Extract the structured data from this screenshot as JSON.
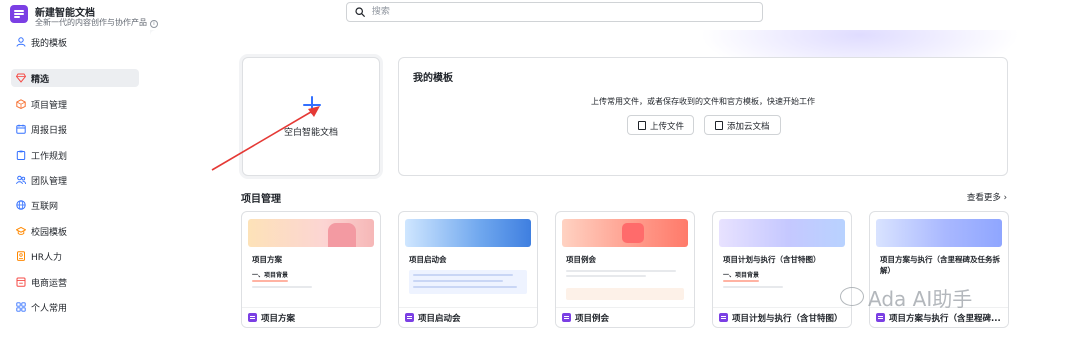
{
  "app": {
    "title": "新建智能文档",
    "subtitle": "全新一代的内容创作与协作产品",
    "brand_color": "#7b3fe4"
  },
  "search": {
    "placeholder": " 搜索"
  },
  "sidebar": {
    "items": [
      {
        "label": "我的模板",
        "icon": "user-icon",
        "active": false
      },
      {
        "label": "精选",
        "icon": "diamond-icon",
        "active": true
      },
      {
        "label": "项目管理",
        "icon": "cube-icon",
        "active": false
      },
      {
        "label": "周报日报",
        "icon": "calendar-icon",
        "active": false
      },
      {
        "label": "工作规划",
        "icon": "clipboard-icon",
        "active": false
      },
      {
        "label": "团队管理",
        "icon": "team-icon",
        "active": false
      },
      {
        "label": "互联网",
        "icon": "globe-icon",
        "active": false
      },
      {
        "label": "校园模板",
        "icon": "graduation-cap-icon",
        "active": false
      },
      {
        "label": "HR人力",
        "icon": "badge-icon",
        "active": false
      },
      {
        "label": "电商运营",
        "icon": "shop-icon",
        "active": false
      },
      {
        "label": "个人常用",
        "icon": "grid-icon",
        "active": false
      }
    ]
  },
  "blank_doc": {
    "label": "空白智能文档",
    "icon": "plus-icon"
  },
  "my_templates": {
    "title": "我的模板",
    "description": "上传常用文件，或者保存收到的文件和官方模板，快速开始工作",
    "upload_label": "上传文件",
    "add_cloud_label": "添加云文档"
  },
  "section": {
    "title": "项目管理",
    "see_more": "查看更多 ›"
  },
  "templates": [
    {
      "card_title": "项目方案",
      "sub_heading": "一、项目背景",
      "name": "项目方案"
    },
    {
      "card_title": "项目启动会",
      "sub_heading": "",
      "name": "项目启动会"
    },
    {
      "card_title": "项目例会",
      "sub_heading": "",
      "name": "项目例会"
    },
    {
      "card_title": "项目计划与执行（含甘特图）",
      "sub_heading": "一、项目背景",
      "name": "项目计划与执行（含甘特图）"
    },
    {
      "card_title": "项目方案与执行（含里程碑及任务拆解）",
      "sub_heading": "",
      "name": "项目方案与执行（含里程碑..."
    }
  ],
  "watermark": {
    "text": "Ada AI助手"
  },
  "colors": {
    "accent": "#3370ff",
    "arrow": "#e53935"
  }
}
